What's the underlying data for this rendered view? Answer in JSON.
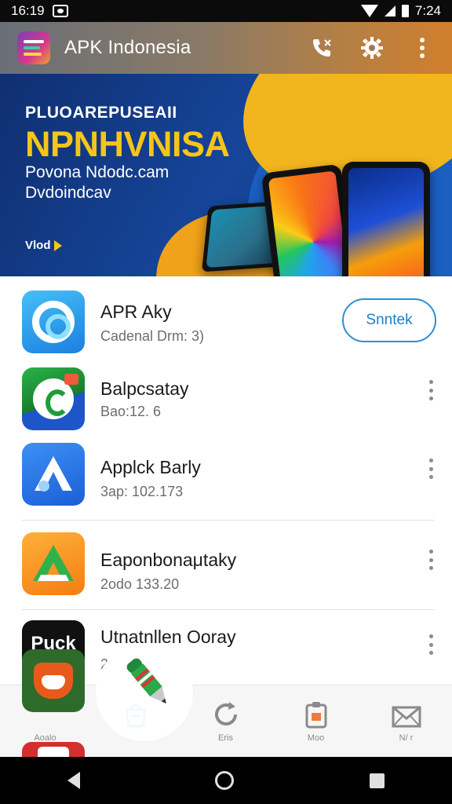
{
  "status_bar": {
    "time_left": "16:19",
    "time_right": "7:24"
  },
  "app_bar": {
    "title": "APK Indonesia",
    "icons": [
      "app-logo",
      "phone-icon",
      "gear-icon",
      "more-vert-icon"
    ]
  },
  "banner": {
    "kicker": "PLUOAREPUSEAII",
    "headline": "NPNHVNISA",
    "line1": "Povona Ndodc.cam",
    "line2": "Dvdoindcav",
    "brand": "Vlod"
  },
  "apps": [
    {
      "title": "APR Aky",
      "subtitle": "Cadenal Drm: 3)",
      "icon": "swirl-icon",
      "action": "Snntek"
    },
    {
      "title": "Balpcsatay",
      "subtitle": "Bao:12. 6",
      "icon": "chat-bubble-icon"
    },
    {
      "title": "Applck Barly",
      "subtitle": "3ap: 102.173",
      "icon": "arrow-a-icon"
    },
    {
      "title": "Eaponbonaμtaky",
      "subtitle": "2odo 133.20",
      "icon": "green-a-icon"
    },
    {
      "title": "Utnatnllen Ooray",
      "subtitle": "2",
      "icon": "puck-icon",
      "icon_text": "Puck"
    }
  ],
  "bottom_nav": [
    {
      "label": "Aoalo",
      "icon": "fox-icon"
    },
    {
      "label": "",
      "icon": "bag-icon",
      "active": true
    },
    {
      "label": "Eris",
      "icon": "refresh-icon"
    },
    {
      "label": "Moo",
      "icon": "clipboard-icon"
    },
    {
      "label": "N/ r",
      "icon": "mail-icon"
    }
  ],
  "colors": {
    "accent": "#2b8fd6",
    "banner_blue": "#16459a",
    "banner_yellow": "#f5c518"
  }
}
